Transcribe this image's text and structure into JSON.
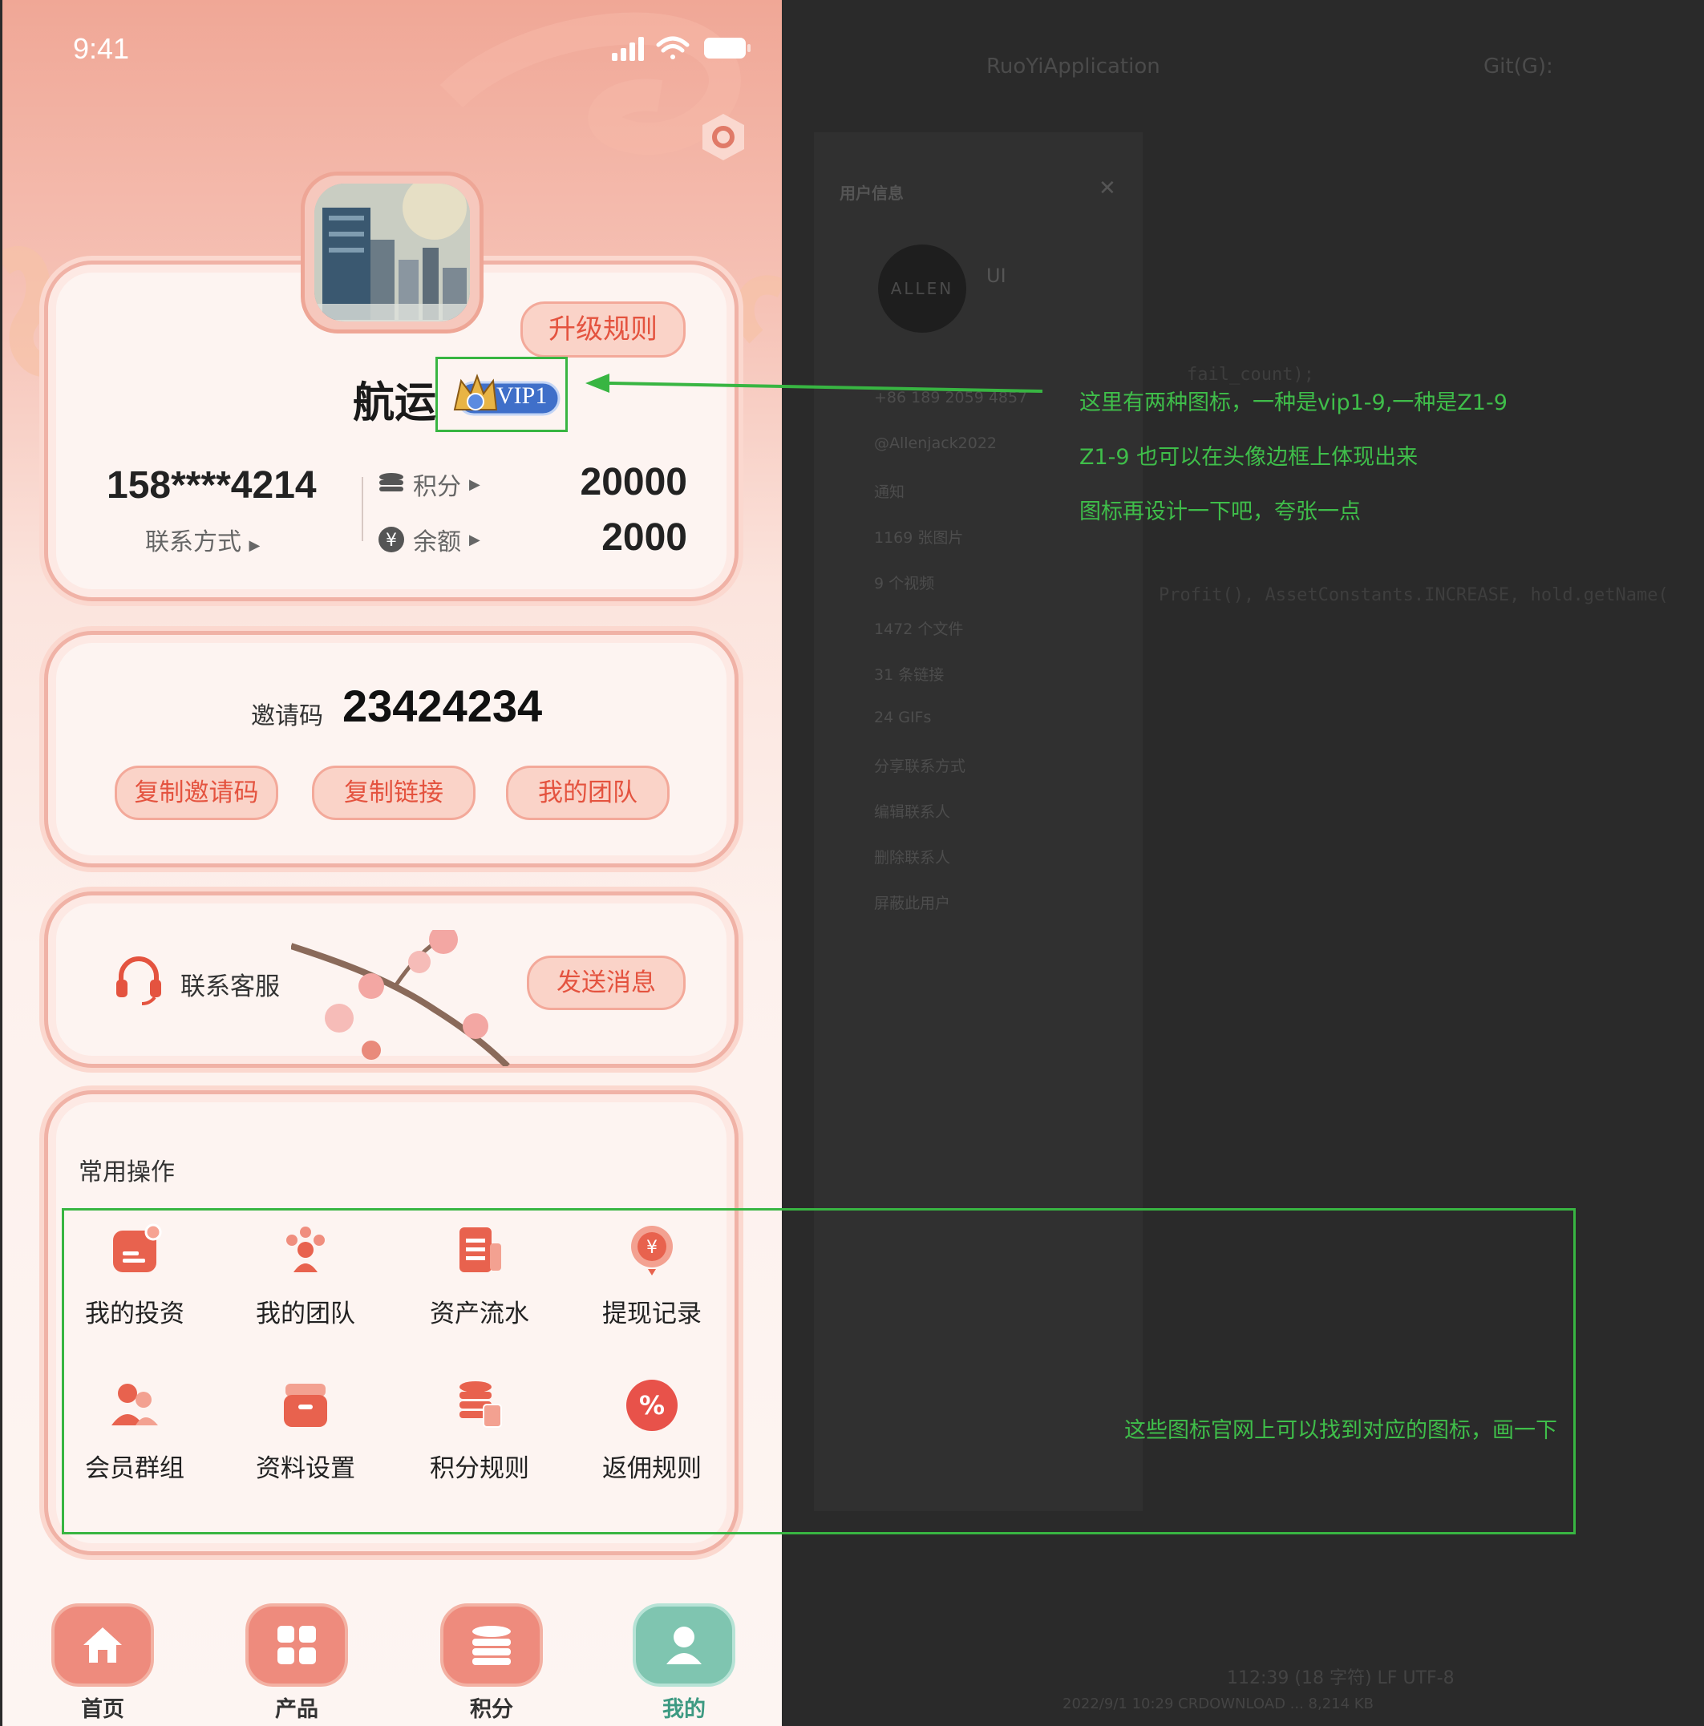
{
  "status_bar": {
    "time": "9:41"
  },
  "profile": {
    "upgrade_rules": "升级规则",
    "name": "航运",
    "vip_badge": "VIP1",
    "phone": "158****4214",
    "contact_label": "联系方式",
    "points_label": "积分",
    "points_value": "20000",
    "balance_label": "余额",
    "balance_value": "2000"
  },
  "invite": {
    "label": "邀请码",
    "code": "23424234",
    "copy_code": "复制邀请码",
    "copy_link": "复制链接",
    "my_team": "我的团队"
  },
  "service": {
    "label": "联系客服",
    "send_message": "发送消息"
  },
  "common_ops": {
    "title": "常用操作",
    "items": [
      {
        "label": "我的投资",
        "icon": "investment-icon"
      },
      {
        "label": "我的团队",
        "icon": "team-icon"
      },
      {
        "label": "资产流水",
        "icon": "asset-flow-icon"
      },
      {
        "label": "提现记录",
        "icon": "withdraw-record-icon"
      },
      {
        "label": "会员群组",
        "icon": "member-group-icon"
      },
      {
        "label": "资料设置",
        "icon": "profile-settings-icon"
      },
      {
        "label": "积分规则",
        "icon": "points-rules-icon"
      },
      {
        "label": "返佣规则",
        "icon": "rebate-rules-icon"
      }
    ]
  },
  "tabbar": [
    {
      "label": "首页",
      "icon": "home-icon"
    },
    {
      "label": "产品",
      "icon": "grid-icon"
    },
    {
      "label": "积分",
      "icon": "coin-stack-icon"
    },
    {
      "label": "我的",
      "icon": "user-icon"
    }
  ],
  "annotations": {
    "line1": "这里有两种图标，一种是vip1-9,一种是Z1-9",
    "line2": "Z1-9  也可以在头像边框上体现出来",
    "line3": "图标再设计一下吧，夸张一点",
    "ops_note": "这些图标官网上可以找到对应的图标，画一下"
  },
  "ide": {
    "app_name": "RuoYiApplication",
    "git_label": "Git(G):",
    "panel_title": "用户信息",
    "panel_user": "UI",
    "avatar_text": "ALLEN",
    "list": [
      "+86 189 2059 4857",
      "@Allenjack2022",
      "通知",
      "1169 张图片",
      "9 个视频",
      "1472 个文件",
      "31 条链接",
      "24 GIFs",
      "分享联系方式",
      "编辑联系人",
      "删除联系人",
      "屏蔽此用户"
    ],
    "code_line1": "fail_count);",
    "code_line2": "Profit(), AssetConstants.INCREASE, hold.getName(",
    "status_line1": "112:39 (18 字符)   LF   UTF-8",
    "status_line2": "2022/9/1 10:29      CRDOWNLOAD ...      8,214 KB"
  },
  "colors": {
    "accent": "#e4533f",
    "annotation_green": "#3fbe4a",
    "active_tab": "#7fc5b0"
  }
}
